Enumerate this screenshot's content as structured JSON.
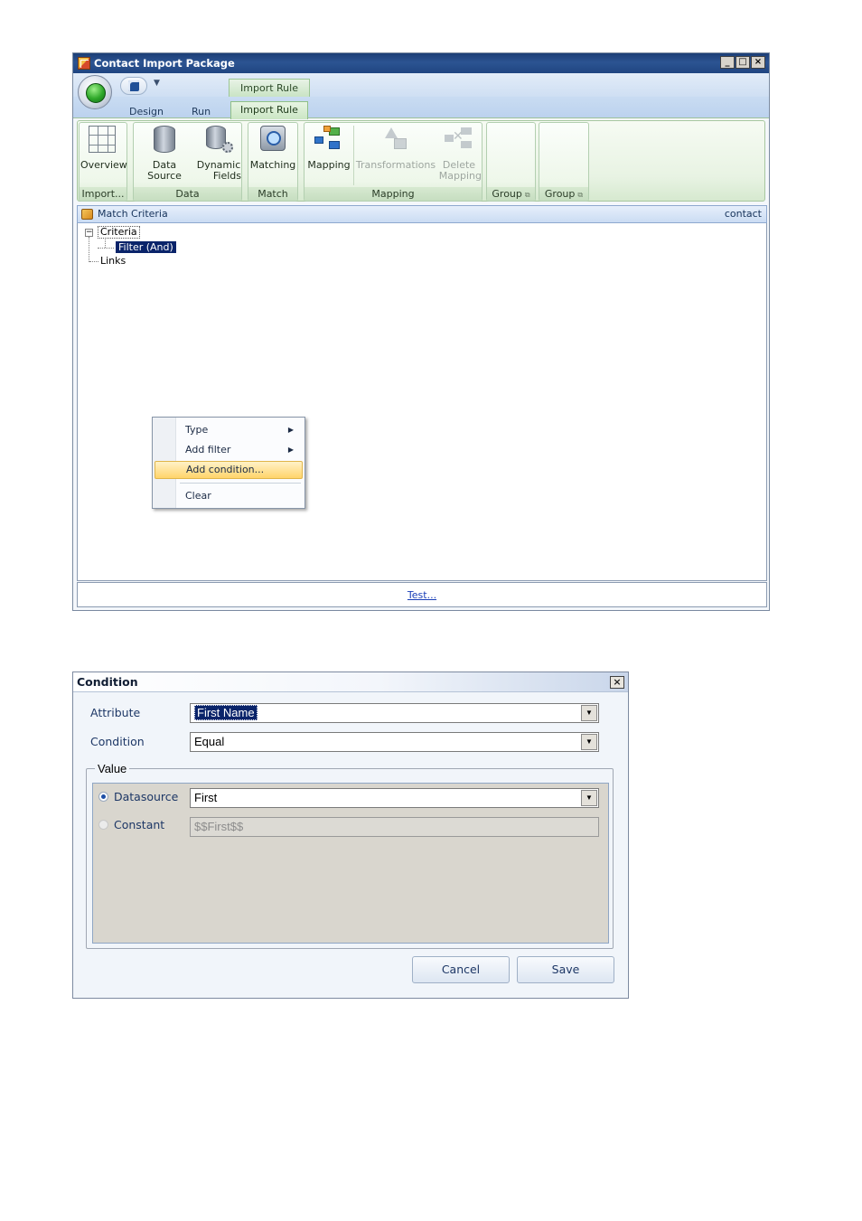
{
  "main_window": {
    "title": "Contact Import Package",
    "controls": {
      "minimize": "_",
      "maximize": "□",
      "close": "×"
    },
    "context_group": "Import Rule",
    "tabs": [
      {
        "label": "Design",
        "active": false
      },
      {
        "label": "Run",
        "active": false
      },
      {
        "label": "Import Rule",
        "active": true
      }
    ],
    "ribbon": {
      "buttons": {
        "overview": "Overview",
        "data_source": "Data Source",
        "dynamic_fields_1": "Dynamic",
        "dynamic_fields_2": "Fields",
        "matching": "Matching",
        "mapping": "Mapping",
        "transformations": "Transformations",
        "delete_mapping_1": "Delete",
        "delete_mapping_2": "Mapping"
      },
      "groups": {
        "import": "Import...",
        "data": "Data",
        "match": "Match",
        "mapping": "Mapping",
        "group1": "Group",
        "group2": "Group"
      },
      "dialog_launcher": "⧉"
    },
    "panel": {
      "title": "Match Criteria",
      "entity": "contact"
    },
    "tree": {
      "expander": "−",
      "criteria": "Criteria",
      "filter": "Filter (And)",
      "links": "Links"
    },
    "context_menu": {
      "items": [
        {
          "label": "Type",
          "submenu_arrow": "▶"
        },
        {
          "label": "Add filter",
          "submenu_arrow": "▶"
        },
        {
          "label": "Add condition..."
        },
        {
          "label": "Clear"
        }
      ]
    },
    "test_link": "Test..."
  },
  "condition_dialog": {
    "title": "Condition",
    "close": "×",
    "attribute_label": "Attribute",
    "attribute_value": "First Name",
    "condition_label": "Condition",
    "condition_value": "Equal",
    "value_group": "Value",
    "datasource_label": "Datasource",
    "datasource_value": "First",
    "datasource_selected": true,
    "constant_label": "Constant",
    "constant_value": "$$First$$",
    "dropdown_arrow": "▼",
    "cancel": "Cancel",
    "save": "Save"
  },
  "colors": {
    "title_bar": "#1f4581",
    "ribbon_green": "#e8f3e3",
    "selection": "#0a246a",
    "menu_highlight": "#ffd46a",
    "link": "#1a3fb8"
  }
}
